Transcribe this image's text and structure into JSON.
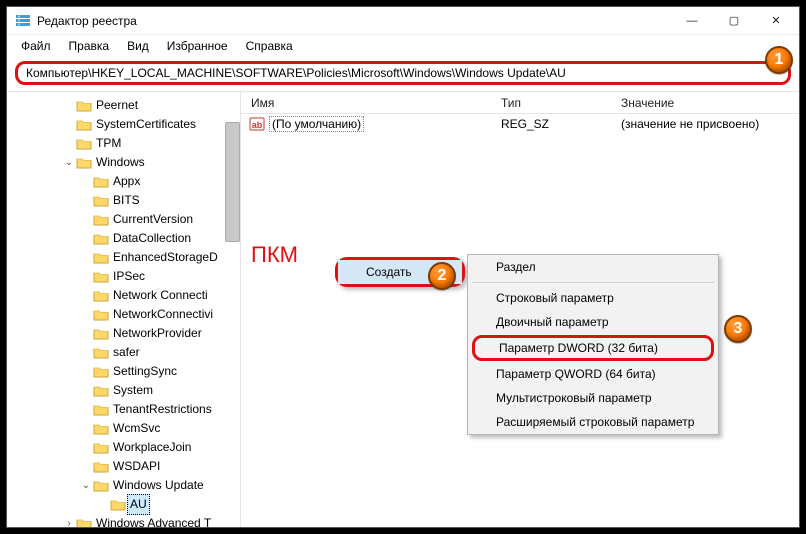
{
  "title": "Редактор реестра",
  "window_controls": {
    "min": "—",
    "max": "▢",
    "close": "✕"
  },
  "menubar": [
    "Файл",
    "Правка",
    "Вид",
    "Избранное",
    "Справка"
  ],
  "address": "Компьютер\\HKEY_LOCAL_MACHINE\\SOFTWARE\\Policies\\Microsoft\\Windows\\Windows Update\\AU",
  "columns": {
    "name": "Имя",
    "type": "Тип",
    "value": "Значение"
  },
  "default_row": {
    "name": "(По умолчанию)",
    "type": "REG_SZ",
    "value": "(значение не присвоено)"
  },
  "pkm": "ПКМ",
  "ctx1": {
    "create": "Создать"
  },
  "ctx2": {
    "section": "Раздел",
    "string": "Строковый параметр",
    "binary": "Двоичный параметр",
    "dword": "Параметр DWORD (32 бита)",
    "qword": "Параметр QWORD (64 бита)",
    "multistring": "Мультистроковый параметр",
    "expand": "Расширяемый строковый параметр"
  },
  "tree": [
    {
      "depth": 3,
      "exp": "",
      "label": "Peernet"
    },
    {
      "depth": 3,
      "exp": "",
      "label": "SystemCertificates"
    },
    {
      "depth": 3,
      "exp": "",
      "label": "TPM"
    },
    {
      "depth": 3,
      "exp": "open",
      "label": "Windows"
    },
    {
      "depth": 4,
      "exp": "",
      "label": "Appx"
    },
    {
      "depth": 4,
      "exp": "",
      "label": "BITS"
    },
    {
      "depth": 4,
      "exp": "",
      "label": "CurrentVersion"
    },
    {
      "depth": 4,
      "exp": "",
      "label": "DataCollection"
    },
    {
      "depth": 4,
      "exp": "",
      "label": "EnhancedStorageD"
    },
    {
      "depth": 4,
      "exp": "",
      "label": "IPSec"
    },
    {
      "depth": 4,
      "exp": "",
      "label": "Network Connecti"
    },
    {
      "depth": 4,
      "exp": "",
      "label": "NetworkConnectivi"
    },
    {
      "depth": 4,
      "exp": "",
      "label": "NetworkProvider"
    },
    {
      "depth": 4,
      "exp": "",
      "label": "safer"
    },
    {
      "depth": 4,
      "exp": "",
      "label": "SettingSync"
    },
    {
      "depth": 4,
      "exp": "",
      "label": "System"
    },
    {
      "depth": 4,
      "exp": "",
      "label": "TenantRestrictions"
    },
    {
      "depth": 4,
      "exp": "",
      "label": "WcmSvc"
    },
    {
      "depth": 4,
      "exp": "",
      "label": "WorkplaceJoin"
    },
    {
      "depth": 4,
      "exp": "",
      "label": "WSDAPI"
    },
    {
      "depth": 4,
      "exp": "open",
      "label": "Windows Update"
    },
    {
      "depth": 5,
      "exp": "",
      "label": "AU",
      "selected": true
    },
    {
      "depth": 3,
      "exp": "closed",
      "label": "Windows Advanced T"
    }
  ],
  "badges": {
    "b1": "1",
    "b2": "2",
    "b3": "3"
  }
}
